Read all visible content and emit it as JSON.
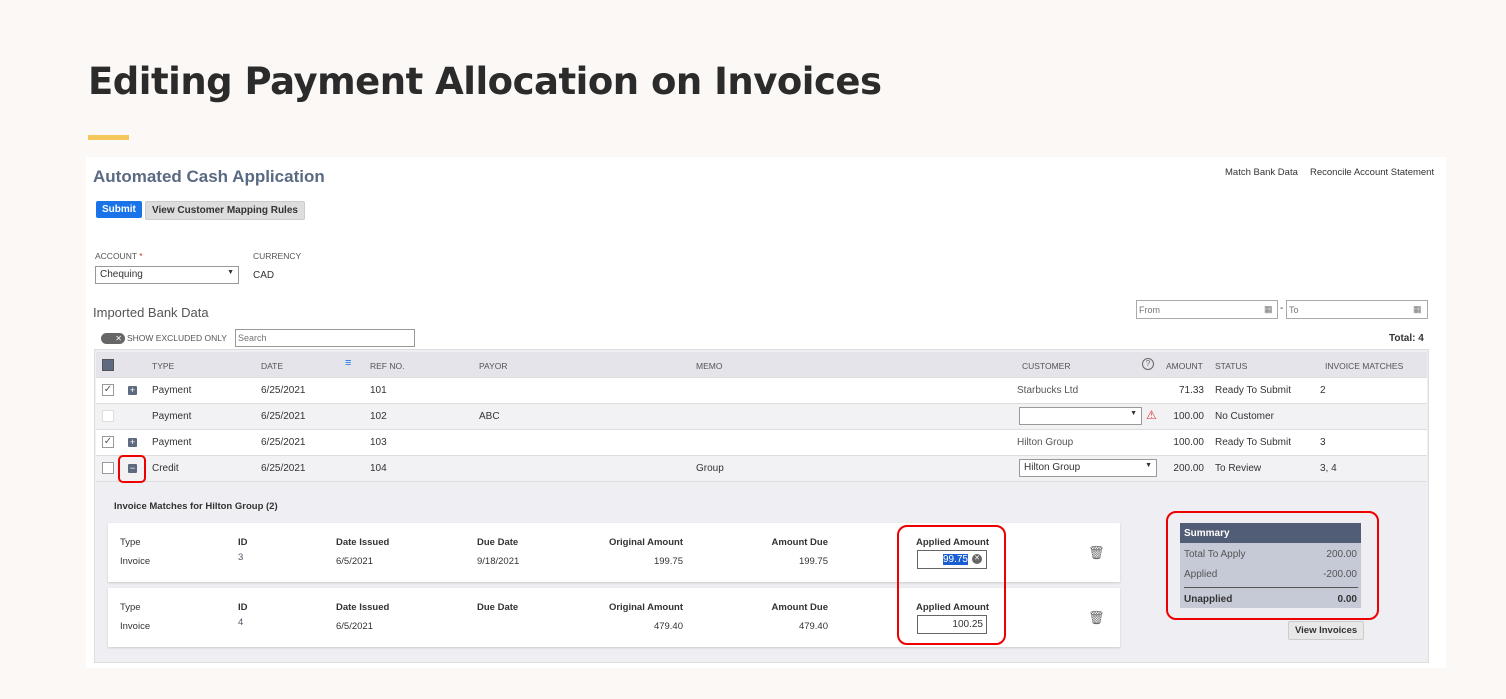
{
  "slide_title": "Editing Payment Allocation on Invoices",
  "app": {
    "title": "Automated Cash Application",
    "links": [
      "Match Bank Data",
      "Reconcile Account Statement"
    ],
    "submit": "Submit",
    "mapping": "View Customer Mapping Rules"
  },
  "account": {
    "label": "ACCOUNT",
    "required": "*",
    "value": "Chequing",
    "currency_label": "CURRENCY",
    "currency": "CAD"
  },
  "bank": {
    "title": "Imported Bank Data",
    "toggle": "SHOW EXCLUDED ONLY",
    "search_ph": "Search",
    "from_ph": "From",
    "to_ph": "To",
    "dash": "-",
    "total": "Total: 4"
  },
  "columns": [
    "TYPE",
    "DATE",
    "REF NO.",
    "PAYOR",
    "MEMO",
    "CUSTOMER",
    "AMOUNT",
    "STATUS",
    "INVOICE MATCHES"
  ],
  "rows": [
    {
      "type": "Payment",
      "date": "6/25/2021",
      "ref": "101",
      "payor": "",
      "memo": "",
      "customer": "Starbucks Ltd",
      "amount": "71.33",
      "status": "Ready To Submit",
      "matches": "2"
    },
    {
      "type": "Payment",
      "date": "6/25/2021",
      "ref": "102",
      "payor": "ABC",
      "memo": "",
      "customer": "",
      "amount": "100.00",
      "status": "No Customer",
      "matches": ""
    },
    {
      "type": "Payment",
      "date": "6/25/2021",
      "ref": "103",
      "payor": "",
      "memo": "",
      "customer": "Hilton Group",
      "amount": "100.00",
      "status": "Ready To Submit",
      "matches": "3"
    },
    {
      "type": "Credit",
      "date": "6/25/2021",
      "ref": "104",
      "payor": "",
      "memo": "Group",
      "customer": "Hilton Group",
      "amount": "200.00",
      "status": "To Review",
      "matches": "3, 4"
    }
  ],
  "matches": {
    "title": "Invoice Matches for Hilton Group (2)",
    "headers": [
      "Type",
      "ID",
      "Date Issued",
      "Due Date",
      "Original Amount",
      "Amount Due",
      "Applied Amount"
    ],
    "items": [
      {
        "type": "Invoice",
        "id": "3",
        "issued": "6/5/2021",
        "due": "9/18/2021",
        "original": "199.75",
        "amount_due": "199.75",
        "applied": "99.75"
      },
      {
        "type": "Invoice",
        "id": "4",
        "issued": "6/5/2021",
        "due": "",
        "original": "479.40",
        "amount_due": "479.40",
        "applied": "100.25"
      }
    ]
  },
  "summary": {
    "title": "Summary",
    "total_label": "Total To Apply",
    "total": "200.00",
    "applied_label": "Applied",
    "applied": "-200.00",
    "unapplied_label": "Unapplied",
    "unapplied": "0.00",
    "view": "View Invoices"
  }
}
